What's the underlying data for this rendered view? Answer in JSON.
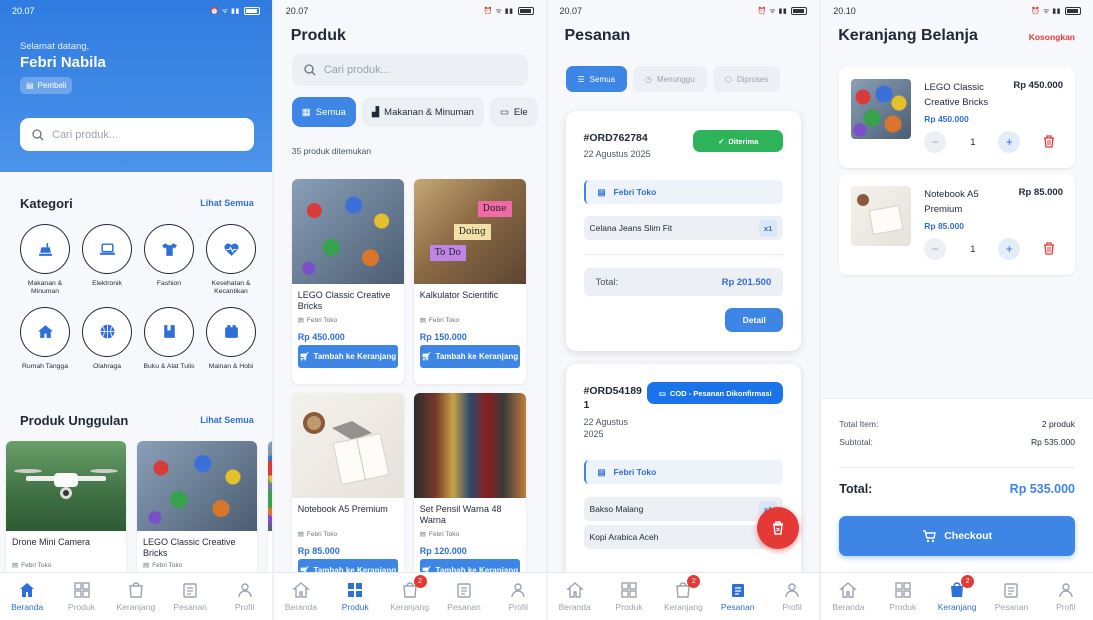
{
  "nav": [
    {
      "key": "home",
      "label": "Beranda"
    },
    {
      "key": "product",
      "label": "Produk"
    },
    {
      "key": "cart",
      "label": "Keranjang"
    },
    {
      "key": "orders",
      "label": "Pesanan"
    },
    {
      "key": "profile",
      "label": "Profil"
    }
  ],
  "cart_badge": "2",
  "screen1": {
    "time": "20.07",
    "welcome": "Selamat datang,",
    "username": "Febri Nabila",
    "role": "Pembeli",
    "search_placeholder": "Cari produk...",
    "categories_title": "Kategori",
    "see_all": "Lihat Semua",
    "categories": [
      {
        "icon": "food-icon",
        "label": "Makanan & Minuman"
      },
      {
        "icon": "laptop-icon",
        "label": "Elektronik"
      },
      {
        "icon": "shirt-icon",
        "label": "Fashion"
      },
      {
        "icon": "heart-pulse-icon",
        "label": "Kesehatan & Kecantikan"
      },
      {
        "icon": "house-icon",
        "label": "Rumah Tangga"
      },
      {
        "icon": "basketball-icon",
        "label": "Olahraga"
      },
      {
        "icon": "book-icon",
        "label": "Buku & Alat Tulis"
      },
      {
        "icon": "toy-icon",
        "label": "Mainan & Hobi"
      }
    ],
    "featured_title": "Produk Unggulan",
    "featured_see_all": "Lihat Semua",
    "featured": [
      {
        "name": "Drone Mini Camera",
        "store": "Febri Toko",
        "image": "drone"
      },
      {
        "name": "LEGO Classic Creative Bricks",
        "store": "Febri Toko",
        "image": "lego"
      }
    ]
  },
  "screen2": {
    "time": "20.07",
    "title": "Produk",
    "search_placeholder": "Cari produk...",
    "chips": [
      "Semua",
      "Makanan & Minuman",
      "Ele"
    ],
    "count": "35 produk ditemukan",
    "add_to_cart": "Tambah ke Keranjang",
    "products": [
      {
        "name": "LEGO Classic Creative Bricks",
        "store": "Febri Toko",
        "price": "Rp 450.000",
        "image": "lego"
      },
      {
        "name": "Kalkulator Scientific",
        "store": "Febri Toko",
        "price": "Rp 150.000",
        "image": "notes"
      },
      {
        "name": "Notebook A5 Premium",
        "store": "Febri Toko",
        "price": "Rp 85.000",
        "image": "book"
      },
      {
        "name": "Set Pensil Warna 48 Warna",
        "store": "Febri Toko",
        "price": "Rp 120.000",
        "image": "shelf"
      }
    ],
    "note_texts": [
      "Done",
      "Doing",
      "To Do"
    ]
  },
  "screen3": {
    "time": "20.07",
    "title": "Pesanan",
    "chips": [
      "Semua",
      "Menunggu",
      "Diproses"
    ],
    "orders": [
      {
        "id": "#ORD762784",
        "date": "22 Agustus 2025",
        "status": "Diterima",
        "status_color": "#2fb35a",
        "store": "Febri Toko",
        "items": [
          {
            "name": "Celana Jeans Slim Fit",
            "qty": "x1"
          }
        ],
        "total_label": "Total:",
        "total": "Rp 201.500",
        "detail": "Detail"
      },
      {
        "id": "#ORD54189",
        "id2": "1",
        "date": "22 Agustus",
        "date2": "2025",
        "status": "COD - Pesanan Dikonfirmasi",
        "status_color": "#1a73e8",
        "store": "Febri Toko",
        "items": [
          {
            "name": "Bakso Malang",
            "qty": "x1"
          },
          {
            "name": "Kopi Arabica Aceh",
            "qty": "x1"
          }
        ]
      }
    ]
  },
  "screen4": {
    "time": "20.10",
    "title": "Keranjang Belanja",
    "clear": "Kosongkan",
    "items": [
      {
        "name": "LEGO Classic Creative Bricks",
        "price": "Rp 450.000",
        "unit_price": "Rp 450.000",
        "qty": "1",
        "image": "lego"
      },
      {
        "name": "Notebook A5 Premium",
        "price": "Rp 85.000",
        "unit_price": "Rp 85.000",
        "qty": "1",
        "image": "book"
      }
    ],
    "total_items_label": "Total Item:",
    "total_items": "2 produk",
    "subtotal_label": "Subtotal:",
    "subtotal": "Rp 535.000",
    "total_label": "Total:",
    "total": "Rp 535.000",
    "checkout": "Checkout"
  },
  "colors": {
    "primary": "#3d86e6",
    "danger": "#e53935",
    "success": "#2fb35a"
  }
}
